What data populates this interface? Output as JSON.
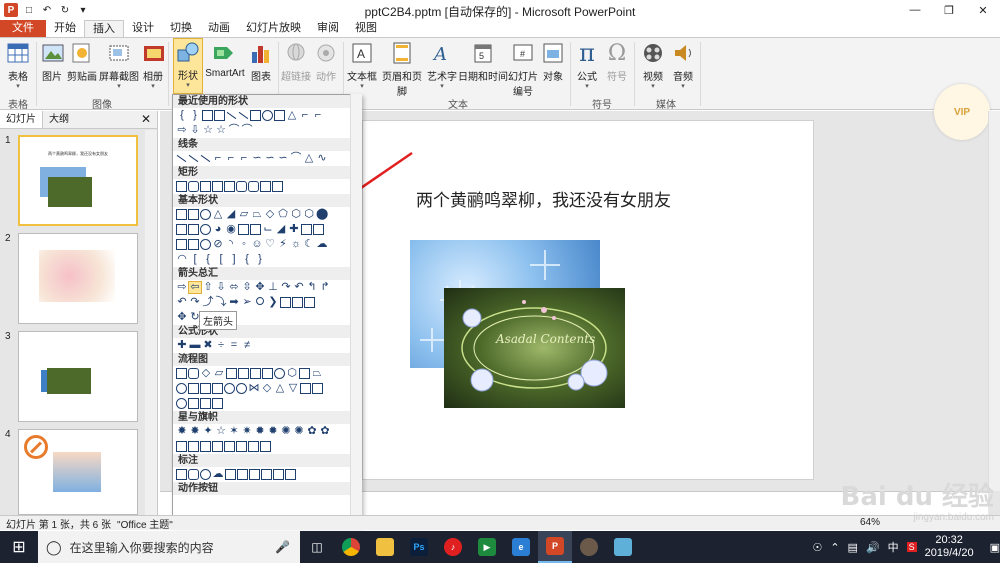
{
  "window": {
    "title": "pptC2B4.pptm [自动保存的] - Microsoft PowerPoint",
    "controls": [
      "minimize-icon",
      "restore-icon",
      "close-icon"
    ]
  },
  "quick_access": [
    "powerpoint-logo-icon",
    "save-icon",
    "undo-icon",
    "redo-icon",
    "customize-icon"
  ],
  "tabs": [
    "文件",
    "开始",
    "插入",
    "设计",
    "切换",
    "动画",
    "幻灯片放映",
    "审阅",
    "视图"
  ],
  "active_tab": "插入",
  "ribbon": {
    "buttons": [
      {
        "label": "表格",
        "icon": "table-icon"
      },
      {
        "label": "图片",
        "icon": "picture-icon"
      },
      {
        "label": "剪贴画",
        "icon": "clipart-icon"
      },
      {
        "label": "屏幕截图",
        "icon": "screenshot-icon"
      },
      {
        "label": "相册",
        "icon": "album-icon"
      },
      {
        "label": "形状",
        "icon": "shapes-icon"
      },
      {
        "label": "SmartArt",
        "icon": "smartart-icon"
      },
      {
        "label": "图表",
        "icon": "chart-icon"
      },
      {
        "label": "超链接",
        "icon": "hyperlink-icon"
      },
      {
        "label": "动作",
        "icon": "action-icon"
      },
      {
        "label": "文本框",
        "icon": "textbox-icon"
      },
      {
        "label": "页眉和页脚",
        "icon": "header-footer-icon"
      },
      {
        "label": "艺术字",
        "icon": "wordart-icon"
      },
      {
        "label": "日期和时间",
        "icon": "date-time-icon"
      },
      {
        "label": "幻灯片",
        "label2": "编号",
        "icon": "slide-number-icon"
      },
      {
        "label": "对象",
        "icon": "object-icon"
      },
      {
        "label": "公式",
        "icon": "equation-icon"
      },
      {
        "label": "符号",
        "icon": "symbol-icon"
      },
      {
        "label": "视频",
        "icon": "video-icon"
      },
      {
        "label": "音频",
        "icon": "audio-icon"
      }
    ],
    "groups": [
      "表格",
      "图像",
      "文本",
      "符号",
      "媒体"
    ]
  },
  "panel": {
    "tabs": [
      "幻灯片",
      "大纲"
    ],
    "thumbnails": [
      {
        "num": "1",
        "text": "两个黄鹂鸣翠柳，我还没有女朋友"
      },
      {
        "num": "2",
        "text": ""
      },
      {
        "num": "3",
        "text": ""
      },
      {
        "num": "4",
        "text": ""
      }
    ]
  },
  "shapes_menu": {
    "sections": [
      "最近使用的形状",
      "线条",
      "矩形",
      "基本形状",
      "箭头总汇",
      "公式形状",
      "流程图",
      "星与旗帜",
      "标注",
      "动作按钮"
    ],
    "tooltip": "左箭头"
  },
  "slide": {
    "title": "两个黄鹂鸣翠柳，我还没有女朋友",
    "image_text": "Asadal Contents"
  },
  "status": {
    "slide_info": "幻灯片 第 1 张，共 6 张",
    "theme": "\"Office 主题\"",
    "zoom": "64%"
  },
  "taskbar": {
    "search_placeholder": "在这里输入你要搜索的内容",
    "apps": [
      "task-view-icon",
      "chrome-icon",
      "file-explorer-icon",
      "photoshop-icon",
      "netease-music-icon",
      "media-player-icon",
      "edge-icon",
      "powerpoint-icon",
      "avatar-icon",
      "notes-icon"
    ],
    "tray": {
      "ime": "中",
      "time": "20:32",
      "date": "2019/4/20"
    }
  },
  "watermark": {
    "text": "Bai du 经验",
    "url": "jingyan.baidu.com"
  }
}
